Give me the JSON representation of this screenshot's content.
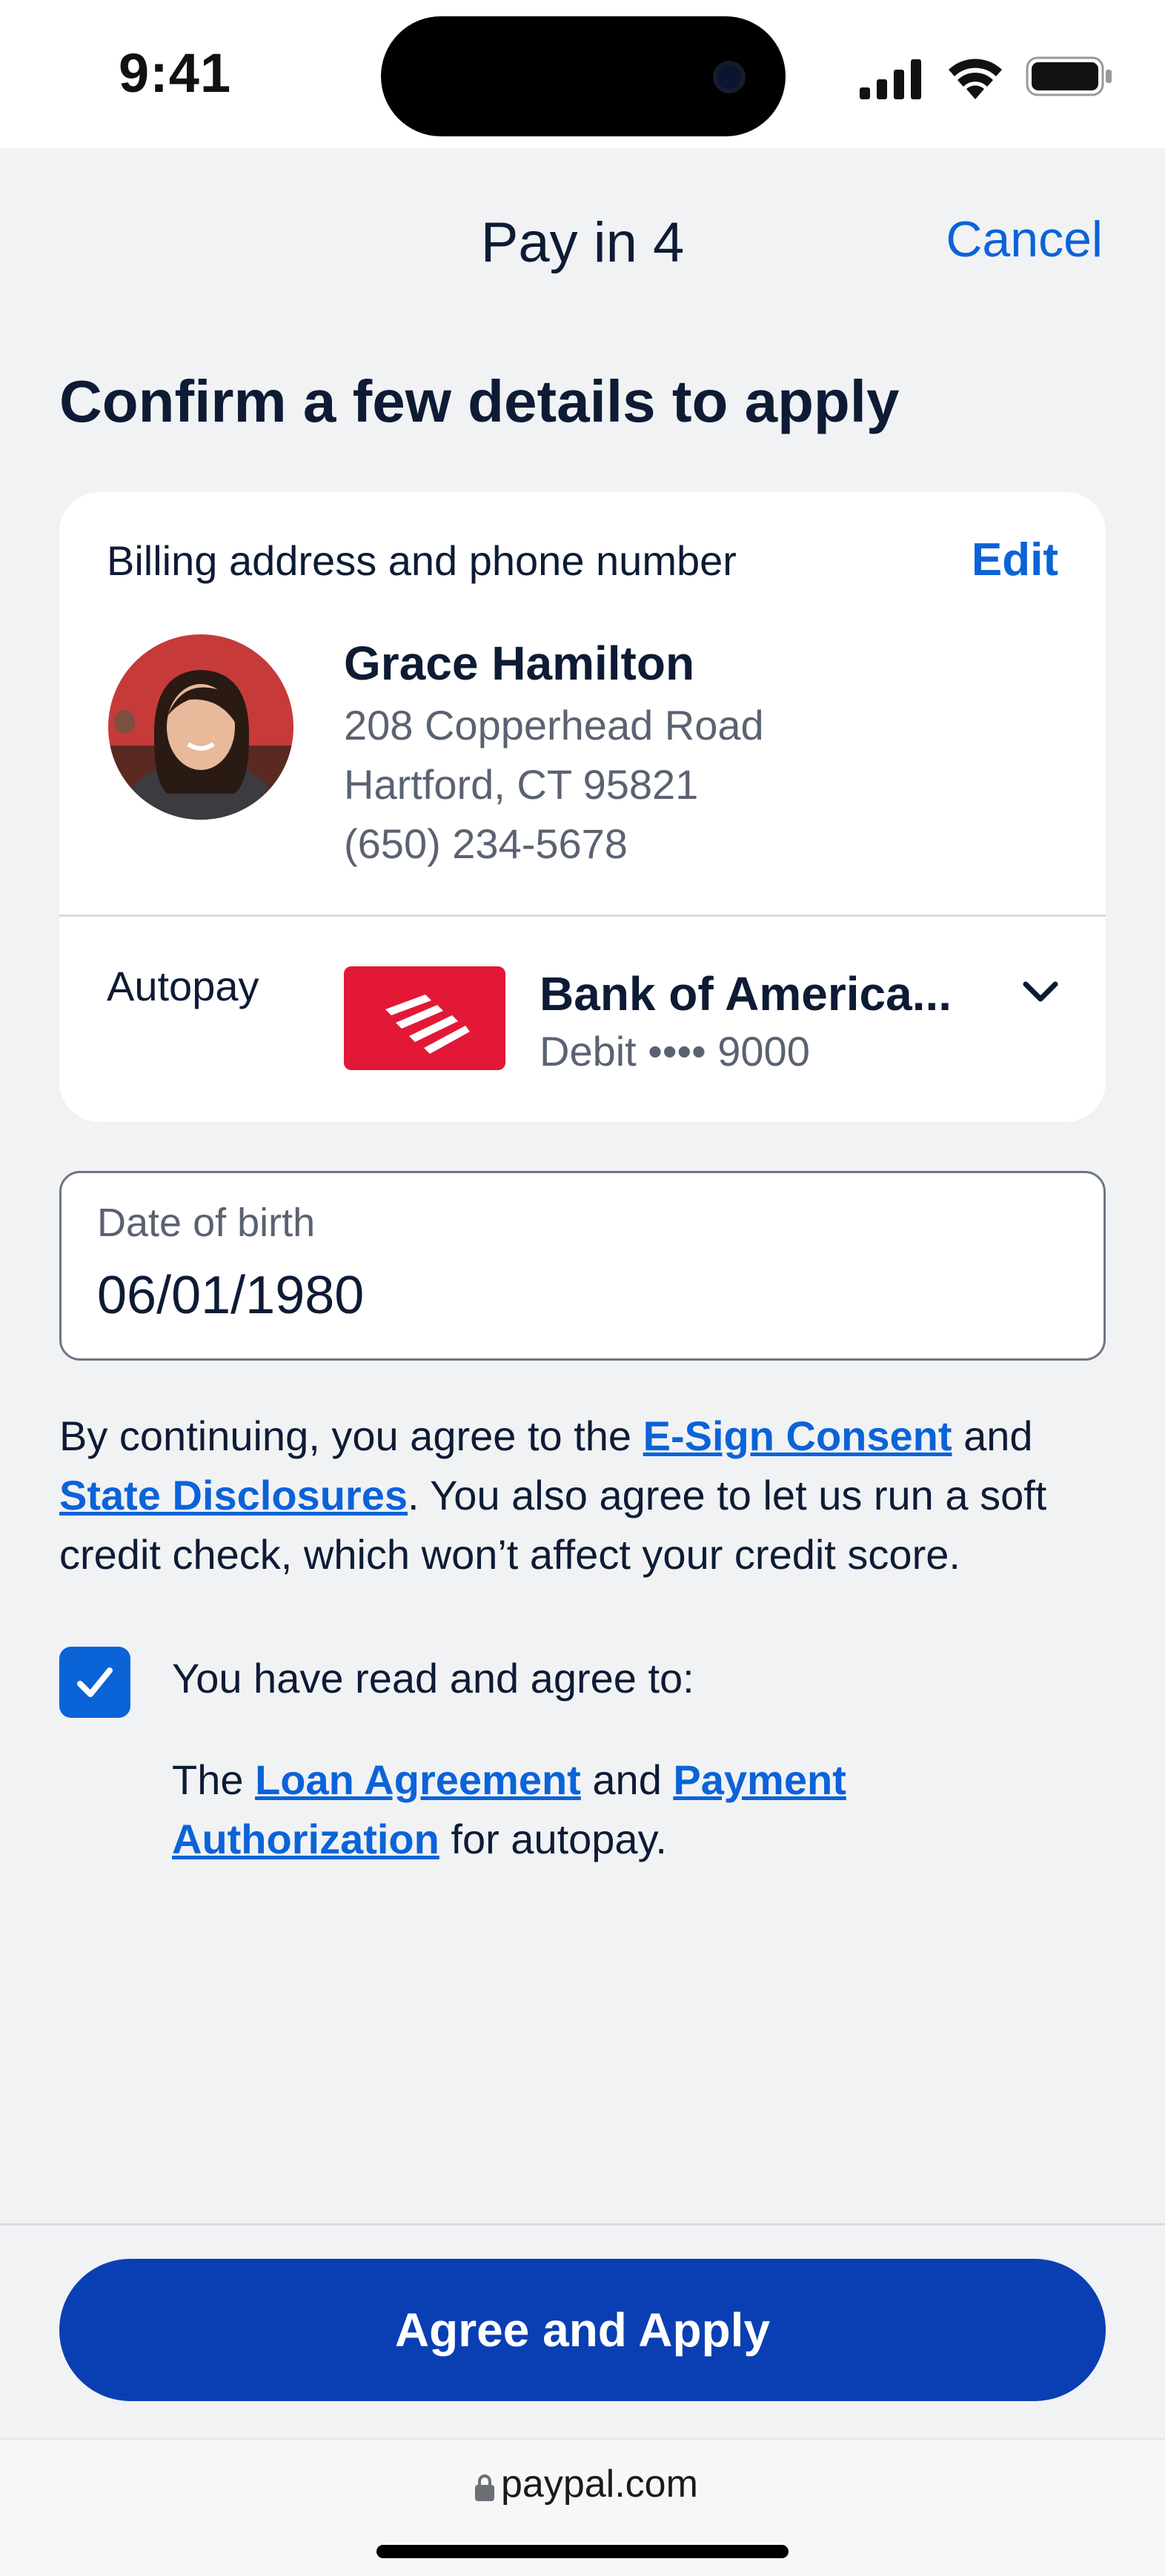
{
  "status_bar": {
    "time": "9:41",
    "icons": [
      "signal-icon",
      "wifi-icon",
      "battery-icon"
    ]
  },
  "header": {
    "title": "Pay in 4",
    "cancel_label": "Cancel"
  },
  "heading": "Confirm a few details to apply",
  "billing": {
    "label": "Billing address and phone number",
    "edit_label": "Edit",
    "name": "Grace Hamilton",
    "address_line1": "208 Copperhead Road",
    "address_line2": "Hartford, CT 95821",
    "phone": "(650) 234-5678"
  },
  "autopay": {
    "label": "Autopay",
    "bank_name": "Bank of  America...",
    "bank_detail": "Debit •••• 9000",
    "icon": "chevron-down-icon"
  },
  "dob": {
    "label": "Date of birth",
    "value": "06/01/1980"
  },
  "consent": {
    "text1": "By continuing, you agree to the ",
    "esign_link": "E-Sign Consent",
    "text2": " and ",
    "state_link": "State Disclosures",
    "text3": ". You also agree to let us run a soft credit check, which won’t affect your credit score."
  },
  "agreement": {
    "checked": true,
    "label": "You have read and agree to:",
    "text1": "The ",
    "loan_link": "Loan Agreement",
    "text2": " and ",
    "payment_link": "Payment Authorization",
    "text3": " for autopay."
  },
  "apply_button": "Agree and Apply",
  "browser": {
    "url": "paypal.com"
  },
  "colors": {
    "accent": "#0b63d8",
    "button": "#0a3fb3",
    "bank_red": "#e31837",
    "background": "#f1f2f4"
  }
}
